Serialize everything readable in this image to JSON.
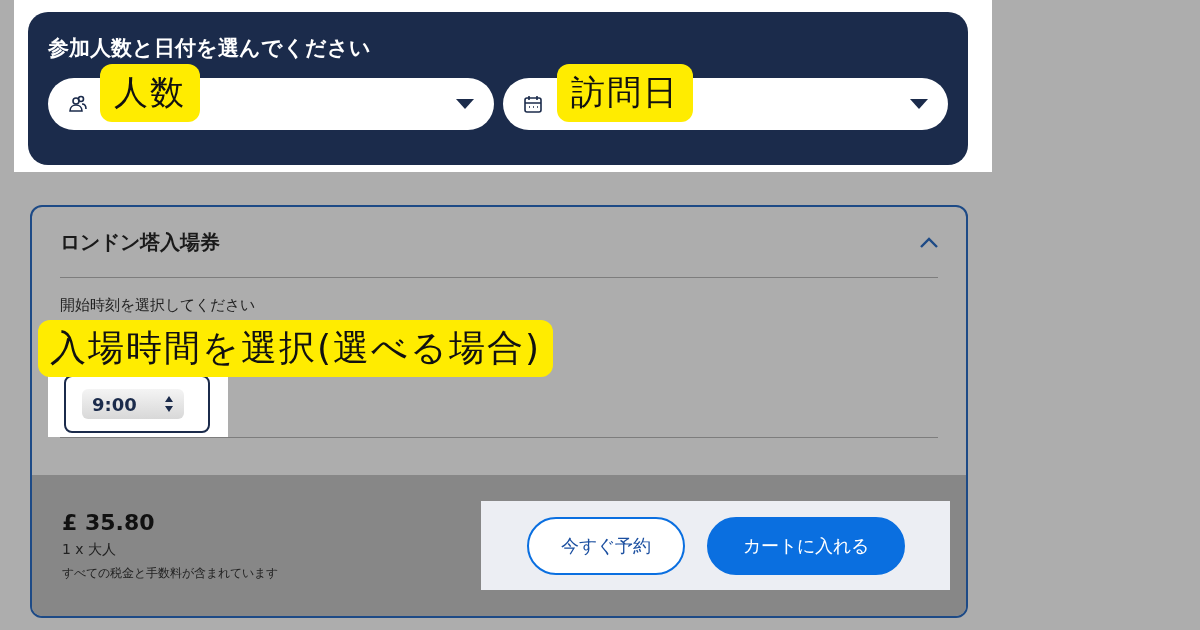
{
  "search_panel": {
    "title": "参加人数と日付を選んでください",
    "fields": [
      {
        "kind": "people",
        "callout": "人数"
      },
      {
        "kind": "date",
        "callout": "訪問日"
      }
    ]
  },
  "ticket": {
    "title": "ロンドン塔入場券",
    "expanded": true,
    "time_label": "開始時刻を選択してください",
    "callout": "入場時間を選択(選べる場合)",
    "time_value": "9:00",
    "price": "£ 35.80",
    "quantity": "1 x 大人",
    "tax_note": "すべての税金と手数料が含まれています",
    "buttons": [
      {
        "kind": "outline",
        "label": "今すぐ予約"
      },
      {
        "kind": "filled",
        "label": "カートに入れる"
      }
    ]
  }
}
